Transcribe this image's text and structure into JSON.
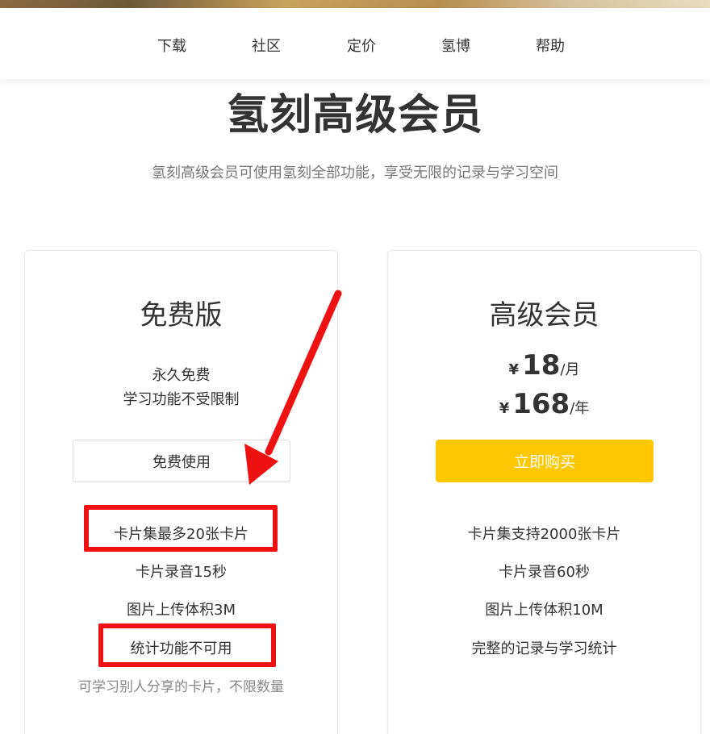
{
  "nav": {
    "items": [
      "下载",
      "社区",
      "定价",
      "氢博",
      "帮助"
    ]
  },
  "page": {
    "title": "氢刻高级会员",
    "subtitle": "氢刻高级会员可使用氢刻全部功能，享受无限的记录与学习空间"
  },
  "free_plan": {
    "title": "免费版",
    "desc_line1": "永久免费",
    "desc_line2": "学习功能不受限制",
    "button_label": "免费使用",
    "features": [
      "卡片集最多20张卡片",
      "卡片录音15秒",
      "图片上传体积3M",
      "统计功能不可用",
      "可学习别人分享的卡片，不限数量"
    ]
  },
  "premium_plan": {
    "title": "高级会员",
    "monthly": {
      "currency": "¥",
      "amount": "18",
      "period": "/月"
    },
    "yearly": {
      "currency": "¥",
      "amount": "168",
      "period": "/年"
    },
    "button_label": "立即购买",
    "features": [
      "卡片集支持2000张卡片",
      "卡片录音60秒",
      "图片上传体积10M",
      "完整的记录与学习统计"
    ]
  },
  "colors": {
    "buy_button": "#ffc700",
    "annotation": "#ee1111"
  },
  "icons": [
    "arrow-annotation-icon"
  ]
}
